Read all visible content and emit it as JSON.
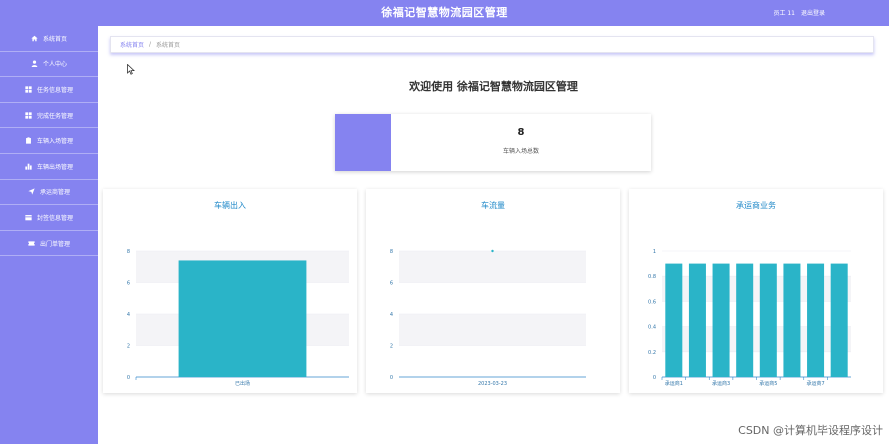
{
  "header": {
    "title": "徐福记智慧物流园区管理",
    "user": "员工 11",
    "logout": "退出登录"
  },
  "sidebar": {
    "items": [
      {
        "label": "系统首页",
        "icon": "home-icon"
      },
      {
        "label": "个人中心",
        "icon": "user-icon"
      },
      {
        "label": "任务信息管理",
        "icon": "grid-icon"
      },
      {
        "label": "完成任务管理",
        "icon": "grid-icon"
      },
      {
        "label": "车辆入场管理",
        "icon": "clipboard-icon"
      },
      {
        "label": "车辆出场管理",
        "icon": "bar-chart-icon"
      },
      {
        "label": "承运商管理",
        "icon": "send-icon"
      },
      {
        "label": "封签信息管理",
        "icon": "seal-icon"
      },
      {
        "label": "出门单管理",
        "icon": "ticket-icon"
      }
    ]
  },
  "breadcrumb": {
    "root": "系统首页",
    "separator": "/",
    "current": "系统首页"
  },
  "welcome": "欢迎使用 徐福记智慧物流园区管理",
  "stat": {
    "value": "8",
    "label": "车辆入场总数"
  },
  "colors": {
    "accent": "#8583f0",
    "bar": "#2ab4c8",
    "title": "#1f88c8"
  },
  "chart_data": [
    {
      "type": "bar",
      "title": "车辆出入",
      "categories": [
        "已出场"
      ],
      "values": [
        7.4
      ],
      "ylim": [
        0,
        8
      ],
      "yticks": [
        "0",
        "2",
        "4",
        "6",
        "8"
      ]
    },
    {
      "type": "line",
      "title": "车流量",
      "categories": [
        "2023-03-23"
      ],
      "values": [
        8
      ],
      "ylim": [
        0,
        8
      ],
      "yticks": [
        "0",
        "2",
        "4",
        "6",
        "8"
      ]
    },
    {
      "type": "bar",
      "title": "承运商业务",
      "categories": [
        "承运商1",
        "承运商2",
        "承运商3",
        "承运商4",
        "承运商5",
        "承运商6",
        "承运商7",
        "承运商8"
      ],
      "visible_category_labels": [
        "承运商1",
        "承运商3",
        "承运商5",
        "承运商7"
      ],
      "values": [
        0.9,
        0.9,
        0.9,
        0.9,
        0.9,
        0.9,
        0.9,
        0.9
      ],
      "ylim": [
        0,
        1
      ],
      "yticks": [
        "0",
        "0.2",
        "0.4",
        "0.6",
        "0.8",
        "1"
      ]
    }
  ],
  "watermark": "CSDN @计算机毕设程序设计"
}
